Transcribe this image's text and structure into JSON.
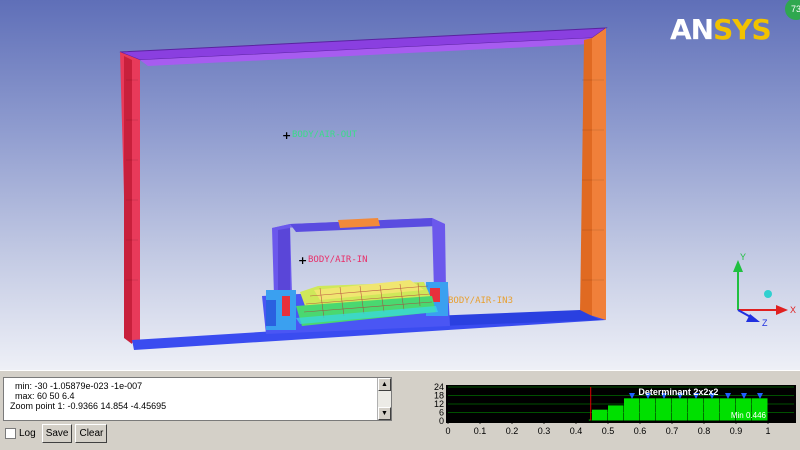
{
  "viewport": {
    "logo": {
      "part1": "AN",
      "part2": "SYS"
    },
    "badge": "73",
    "labels": {
      "air_out": "BODY/AIR-OUT",
      "air_in": "BODY/AIR-IN",
      "air_in3": "BODY/AIR-IN3"
    },
    "triad": {
      "x": "X",
      "y": "Y",
      "z": "Z"
    }
  },
  "console": {
    "line1": "  min: -30 -1.05879e-023 -1e-007",
    "line2": "  max: 60 50 6.4",
    "line3": "Zoom point 1: -0.9366 14.854 -4.45695"
  },
  "controls": {
    "log_label": "Log",
    "save_label": "Save",
    "clear_label": "Clear"
  },
  "chart_data": {
    "type": "bar",
    "title": "Determinant 2x2x2",
    "annotation": "Min 0.446",
    "x_ticks": [
      "0",
      "0.1",
      "0.2",
      "0.3",
      "0.4",
      "0.5",
      "0.6",
      "0.7",
      "0.8",
      "0.9",
      "1"
    ],
    "y_ticks": [
      "0",
      "6",
      "12",
      "18",
      "24"
    ],
    "xlim": [
      0,
      1
    ],
    "ylim": [
      0,
      24
    ],
    "bars": [
      {
        "x0": 0.44,
        "x1": 0.45,
        "value": 1
      },
      {
        "x0": 0.45,
        "x1": 0.5,
        "value": 8
      },
      {
        "x0": 0.5,
        "x1": 0.55,
        "value": 11
      },
      {
        "x0": 0.55,
        "x1": 0.6,
        "value": 16
      },
      {
        "x0": 0.6,
        "x1": 0.65,
        "value": 16
      },
      {
        "x0": 0.65,
        "x1": 0.7,
        "value": 16
      },
      {
        "x0": 0.7,
        "x1": 0.75,
        "value": 16
      },
      {
        "x0": 0.75,
        "x1": 0.8,
        "value": 16
      },
      {
        "x0": 0.8,
        "x1": 0.85,
        "value": 16
      },
      {
        "x0": 0.85,
        "x1": 0.9,
        "value": 16
      },
      {
        "x0": 0.9,
        "x1": 0.95,
        "value": 16
      },
      {
        "x0": 0.95,
        "x1": 1.0,
        "value": 16
      }
    ],
    "colors": {
      "bars": "#00e000",
      "background": "#000000",
      "grid": "#00a000",
      "min_line": "#e00000",
      "arrows": "#2060ff"
    }
  }
}
